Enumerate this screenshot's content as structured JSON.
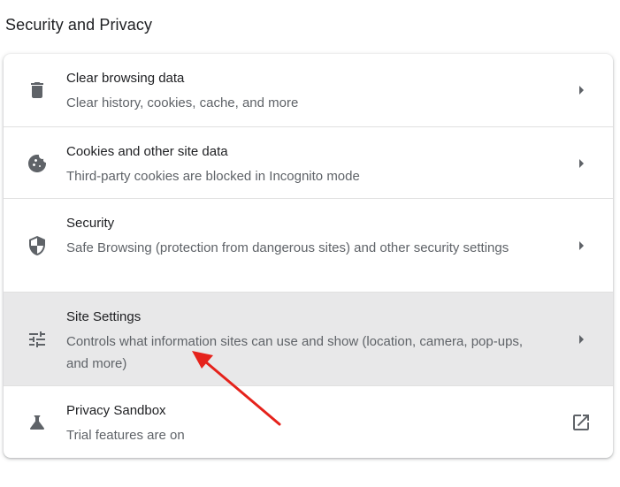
{
  "section": {
    "title": "Security and Privacy"
  },
  "rows": [
    {
      "title": "Clear browsing data",
      "subtitle": "Clear history, cookies, cache, and more",
      "icon": "trash-icon",
      "action_icon": "chevron-right-icon"
    },
    {
      "title": "Cookies and other site data",
      "subtitle": "Third-party cookies are blocked in Incognito mode",
      "icon": "cookie-icon",
      "action_icon": "chevron-right-icon"
    },
    {
      "title": "Security",
      "subtitle": "Safe Browsing (protection from dangerous sites) and other security settings",
      "icon": "shield-icon",
      "action_icon": "chevron-right-icon"
    },
    {
      "title": "Site Settings",
      "subtitle": "Controls what information sites can use and show (location, camera, pop-ups, and more)",
      "icon": "tune-sliders-icon",
      "action_icon": "chevron-right-icon",
      "highlighted": true
    },
    {
      "title": "Privacy Sandbox",
      "subtitle": "Trial features are on",
      "icon": "flask-icon",
      "action_icon": "open-in-new-icon"
    }
  ],
  "colors": {
    "highlight_row": "#e8e8e9",
    "annotation_arrow": "#e5221b",
    "icon": "#5f6368"
  }
}
